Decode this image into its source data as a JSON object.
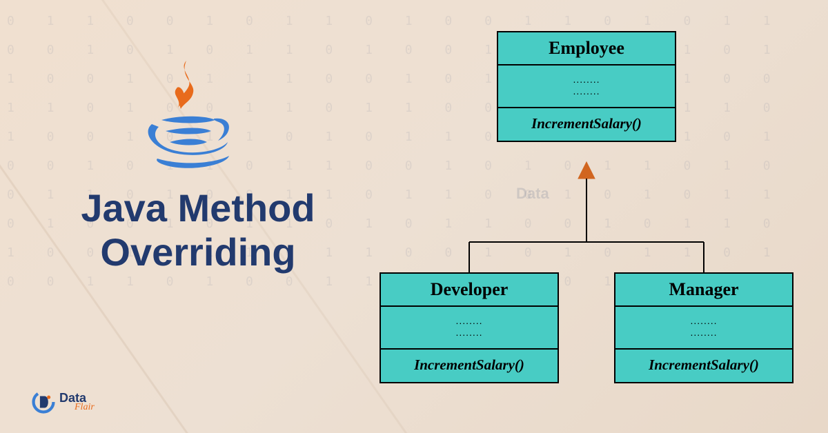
{
  "title_line1": "Java Method",
  "title_line2": "Overriding",
  "brand": {
    "line1": "Data",
    "line2": "Flair"
  },
  "diagram": {
    "parent": {
      "name": "Employee",
      "body": "........\n........",
      "method": "IncrementSalary()"
    },
    "children": [
      {
        "name": "Developer",
        "body": "........\n........",
        "method": "IncrementSalary()"
      },
      {
        "name": "Manager",
        "body": "........\n........",
        "method": "IncrementSalary()"
      }
    ]
  },
  "colors": {
    "primary": "#223a6e",
    "accent": "#e86b1c",
    "box_fill": "#48ccc4"
  },
  "bg_binary": "0 1 1 0 0 1 0 1 1 0 1 0 0 1 1 0 1 0 1 1 0 0 1 0 1 0 1 1 0 1 0 0 1 0 1 1 0 1 0 1 1 0 0 1 0 1 1 1 0 0 1 0 1 0 1 1 0 1 0 0 1 1 0 1 0 0 1 1 0 1 1 0 0 1 0 1 0 1 1 0 1 0 0 1 0 1 1 0 1 0 1 1 0 0 1 0 1 1 0 1 0 0 1 0 1 1 0 1 1 0 0 1 0 1 0 1 1 0 1 0 0 1 1 0 1 0 0 1 1 0 1 1 0 0 1 0 1 0 1 1 0 1 0 0 1 0 1 1 0 1 0 1 1 0 0 1 0 1 1 0 1 0 0 1 0 1 1 0 1 1 0 0 1 0 1 0 1 1 0 1 0 0 1 1 0 1 0 0 1 1 0 1 1 0 0 1 0 1 0 1"
}
